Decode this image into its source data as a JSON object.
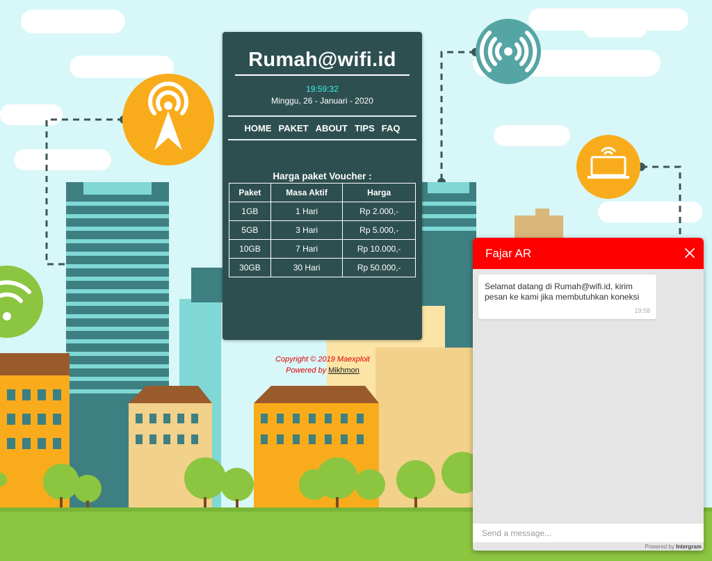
{
  "site": {
    "title": "Rumah@wifi.id",
    "time": "19:59:32",
    "date": "Minggu, 26 - Januari - 2020"
  },
  "nav": {
    "items": [
      "HOME",
      "PAKET",
      "ABOUT",
      "TIPS",
      "FAQ"
    ]
  },
  "voucher": {
    "title": "Harga paket Voucher :",
    "headers": [
      "Paket",
      "Masa Aktif",
      "Harga"
    ],
    "rows": [
      [
        "1GB",
        "1 Hari",
        "Rp 2.000,-"
      ],
      [
        "5GB",
        "3 Hari",
        "Rp 5.000,-"
      ],
      [
        "10GB",
        "7 Hari",
        "Rp 10.000,-"
      ],
      [
        "30GB",
        "30 Hari",
        "Rp 50.000,-"
      ]
    ]
  },
  "footer": {
    "copyright": "Copyright © 2019 Maexploit",
    "powered_prefix": "Powered by ",
    "powered_link": "Mikhmon"
  },
  "chat": {
    "agent_name": "Fajar AR",
    "message": "Selamat datang di Rumah@wifi.id, kirim pesan ke kami jika membutuhkan koneksi",
    "message_time": "19:58",
    "input_placeholder": "Send a message...",
    "powered_prefix": "Powered by ",
    "powered_brand": "Intergram"
  },
  "colors": {
    "panel": "#2e4f4f",
    "chat_header": "#ff0000",
    "clock": "#3ff0ee",
    "sky": "#d8f7f8",
    "grass": "#8cc540"
  },
  "icons": [
    "antenna-tower-icon",
    "wifi-signal-icon",
    "laptop-wifi-icon",
    "wifi-icon",
    "close-icon"
  ]
}
